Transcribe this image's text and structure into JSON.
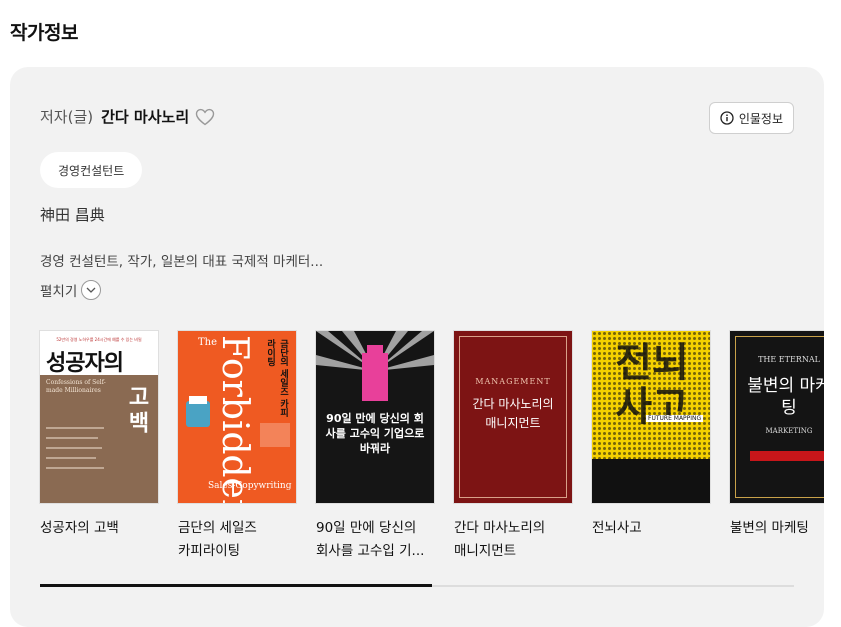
{
  "page_title": "작가정보",
  "author": {
    "role": "저자(글)",
    "name": "간다 마사노리",
    "info_button": "인물정보",
    "tag": "경영컨설턴트",
    "original_name": "神田 昌典",
    "description": "경영 컨설턴트, 작가, 일본의 대표 국제적 마케터...",
    "expand_label": "펼치기"
  },
  "books": [
    {
      "title": "성공자의 고백",
      "cover": {
        "top": "52만의 경영 노하우를 24시간에 예를 수 있는 비밀",
        "big": "성공자의",
        "sub": "고백",
        "eng": "Confessions of Self-made Millionaires"
      }
    },
    {
      "title": "금단의 세일즈 카피라이팅",
      "cover": {
        "big": "Forbidden",
        "ko": "금단의 세일즈 카피라이팅",
        "eng": "Sales-Copywriting",
        "small": "The"
      }
    },
    {
      "title": "90일 만에 당신의 회사를 고수입 기...",
      "cover": {
        "big": "90일 만에 당신의 회사를 고수익 기업으로 바꿔라"
      }
    },
    {
      "title": "간다 마사노리의 매니지먼트",
      "cover": {
        "eng": "MANAGEMENT",
        "big": "간다 마사노리의 매니지먼트"
      }
    },
    {
      "title": "전뇌사고",
      "cover": {
        "big": "전뇌사고",
        "eng": "FUTURE MAPPING"
      }
    },
    {
      "title": "불변의 마케팅",
      "cover": {
        "eng": "THE ETERNAL",
        "big": "불변의 마케팅",
        "eng2": "MARKETING"
      }
    }
  ],
  "scroll": {
    "position": 0.52
  }
}
